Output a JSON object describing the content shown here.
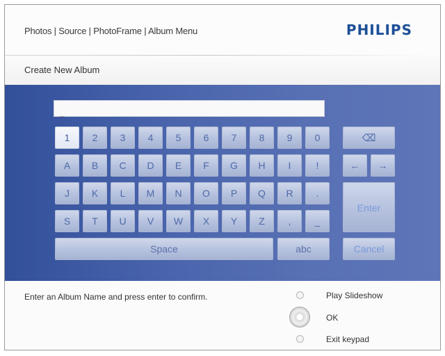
{
  "header": {
    "breadcrumb": "Photos | Source | PhotoFrame | Album Menu",
    "logo": "PHILIPS"
  },
  "page": {
    "title": "Create New Album"
  },
  "input": {
    "value": "_"
  },
  "keys": {
    "row1": [
      "1",
      "2",
      "3",
      "4",
      "5",
      "6",
      "7",
      "8",
      "9",
      "0"
    ],
    "row2": [
      "A",
      "B",
      "C",
      "D",
      "E",
      "F",
      "G",
      "H",
      "I",
      "!"
    ],
    "row3": [
      "J",
      "K",
      "L",
      "M",
      "N",
      "O",
      "P",
      "Q",
      "R",
      "."
    ],
    "row4": [
      "S",
      "T",
      "U",
      "V",
      "W",
      "X",
      "Y",
      "Z",
      ",",
      "_"
    ],
    "space": "Space",
    "abc": "abc",
    "backspace_icon": "⌫",
    "left_icon": "←",
    "right_icon": "→",
    "enter": "Enter",
    "cancel": "Cancel"
  },
  "footer": {
    "instruction": "Enter an Album Name and press enter to confirm.",
    "options": [
      {
        "label": "Play Slideshow"
      },
      {
        "label": "OK"
      },
      {
        "label": "Exit keypad"
      }
    ]
  },
  "colors": {
    "panel": "#4b66ad",
    "key": "#b5c1de",
    "key_text": "#4e6aa6",
    "logo": "#1d4f97"
  }
}
